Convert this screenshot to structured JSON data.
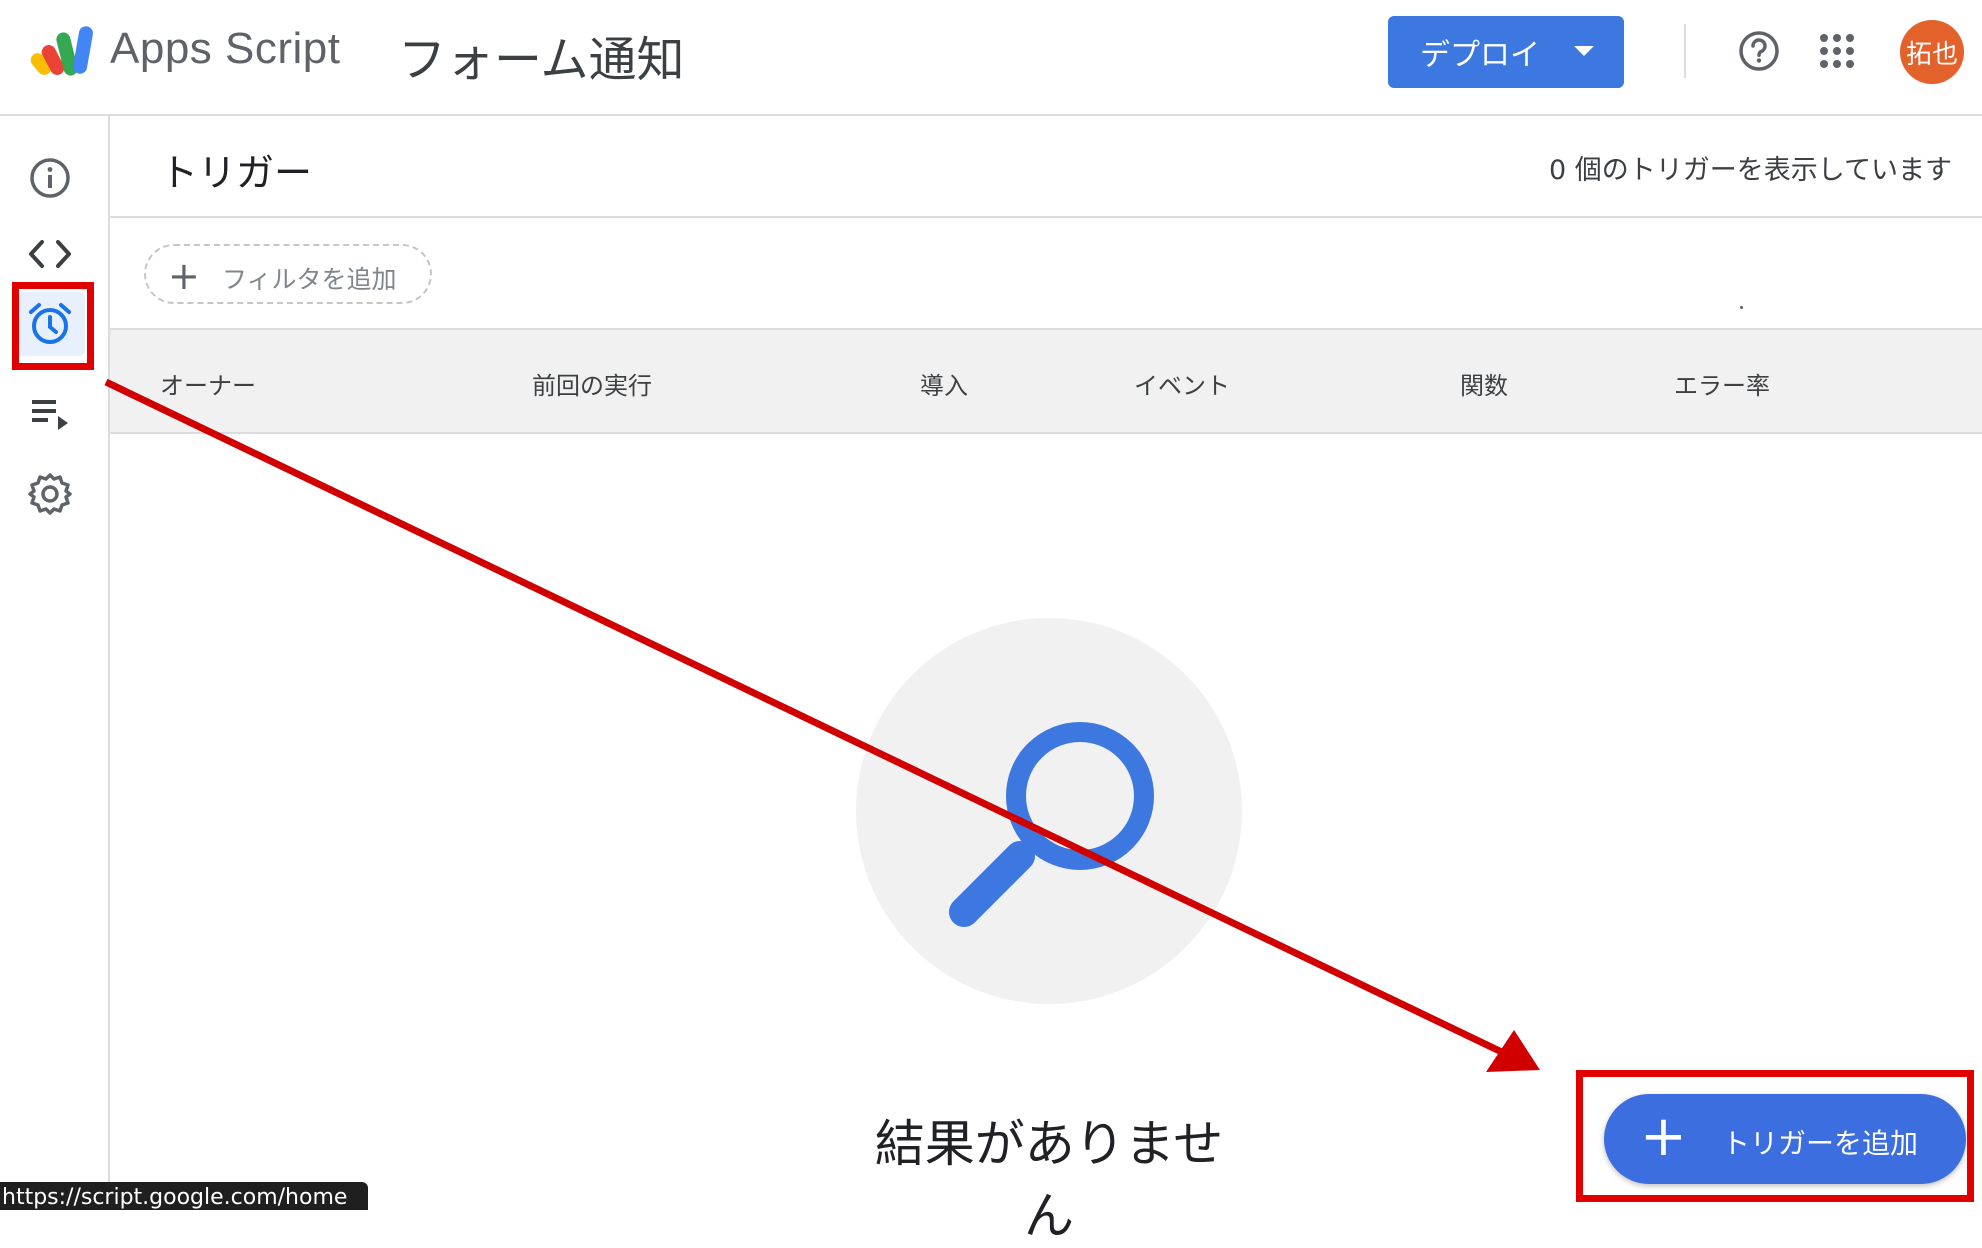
{
  "topbar": {
    "app_name": "Apps Script",
    "project_title": "フォーム通知",
    "deploy_label": "デプロイ",
    "avatar_text": "拓也",
    "icons": [
      "apps-script-logo",
      "help-icon",
      "google-apps-grid-icon"
    ]
  },
  "rail": {
    "items": [
      {
        "name": "overview",
        "icon": "info-icon",
        "active": false
      },
      {
        "name": "editor",
        "icon": "code-icon",
        "active": false
      },
      {
        "name": "triggers",
        "icon": "alarm-clock-icon",
        "active": true
      },
      {
        "name": "executions",
        "icon": "playlist-icon",
        "active": false
      },
      {
        "name": "settings",
        "icon": "gear-icon",
        "active": false
      }
    ]
  },
  "main": {
    "title": "トリガー",
    "trigger_count": "0 個のトリガーを表示しています",
    "filter_label": "フィルタを追加",
    "columns": [
      "オーナー",
      "前回の実行",
      "導入",
      "イベント",
      "関数",
      "エラー率"
    ],
    "empty_text": "結果がありません",
    "add_trigger_label": "トリガーを追加"
  },
  "status_url": "https://script.google.com/home",
  "colors": {
    "accent": "#3c78e0",
    "annotation_red": "#e00000",
    "avatar": "#e3612b",
    "active_icon": "#1a73e8"
  }
}
